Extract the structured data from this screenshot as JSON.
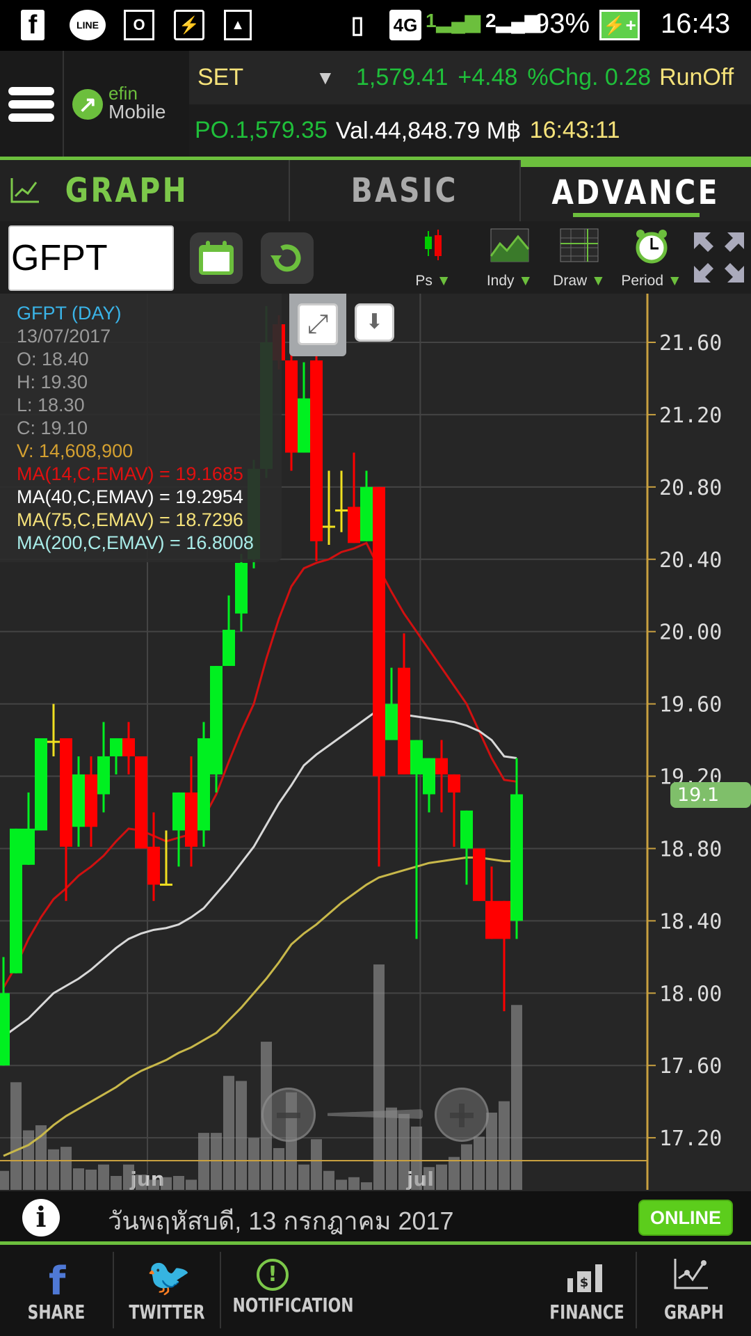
{
  "status_bar": {
    "left_icons": [
      "facebook-icon",
      "line-icon",
      "outlook-icon",
      "battery-saver-icon",
      "gallery-icon"
    ],
    "line_label": "LINE",
    "network": "4G",
    "sim1": "1",
    "sim2": "2",
    "battery": "93%",
    "time": "16:43"
  },
  "header": {
    "logo_line1": "efin",
    "logo_line2": "Mobile",
    "index_name": "SET",
    "index_value": "1,579.41",
    "index_change": "+4.48",
    "pct_change": "%Chg. 0.28",
    "runoff": "RunOff",
    "po": "PO.1,579.35",
    "value": "Val.44,848.79 M฿",
    "timestamp": "16:43:11"
  },
  "tabs": {
    "graph": "GRAPH",
    "basic": "BASIC",
    "advance": "ADVANCE",
    "active": "ADVANCE"
  },
  "toolbar": {
    "symbol": "GFPT",
    "ps": "Ps",
    "indy": "Indy",
    "draw": "Draw",
    "period": "Period",
    "arrow": "▼"
  },
  "info_overlay": {
    "title": "GFPT (DAY)",
    "date": "13/07/2017",
    "open": "O: 18.40",
    "high": "H: 19.30",
    "low": "L: 18.30",
    "close": "C: 19.10",
    "volume": "V: 14,608,900",
    "ma14": "MA(14,C,EMAV) = 19.1685",
    "ma40": "MA(40,C,EMAV) = 19.2954",
    "ma75": "MA(75,C,EMAV) = 18.7296",
    "ma200": "MA(200,C,EMAV) = 16.8008"
  },
  "colors": {
    "up": "#00f020",
    "down": "#ff0000",
    "doji": "#f0e020",
    "ma14": "#d01010",
    "ma40": "#d8d8d8",
    "ma75": "#c8b84a",
    "axis": "#c8a040",
    "accent": "#6cbf3d"
  },
  "chart_data": {
    "type": "candlestick",
    "title": "GFPT (DAY)",
    "ylim": [
      17.07,
      21.87
    ],
    "y_ticks": [
      "21.60",
      "21.20",
      "20.80",
      "20.40",
      "20.00",
      "19.60",
      "19.20",
      "18.80",
      "18.40",
      "18.00",
      "17.60",
      "17.20"
    ],
    "x_labels": [
      {
        "label": "jun",
        "index": 11.5
      },
      {
        "label": "jul",
        "index": 33.3
      }
    ],
    "last_price_label": "19.1",
    "last_price": 19.1,
    "candles": [
      [
        17.6,
        18.2,
        17.6,
        18.0
      ],
      [
        18.11,
        18.91,
        18.11,
        18.91
      ],
      [
        18.71,
        19.11,
        18.71,
        18.91
      ],
      [
        18.9,
        19.41,
        18.9,
        19.41
      ],
      [
        19.39,
        19.6,
        19.31,
        19.39
      ],
      [
        19.41,
        19.41,
        18.51,
        18.81
      ],
      [
        18.92,
        19.31,
        18.81,
        19.21
      ],
      [
        19.21,
        19.31,
        18.81,
        18.92
      ],
      [
        19.1,
        19.5,
        19.0,
        19.31
      ],
      [
        19.31,
        19.41,
        19.21,
        19.41
      ],
      [
        19.41,
        19.5,
        19.21,
        19.31
      ],
      [
        19.31,
        19.31,
        18.8,
        18.8
      ],
      [
        18.81,
        19.0,
        18.51,
        18.6
      ],
      [
        18.6,
        18.9,
        18.6,
        18.6
      ],
      [
        18.9,
        19.11,
        18.7,
        19.11
      ],
      [
        19.11,
        19.31,
        18.7,
        18.81
      ],
      [
        18.9,
        19.5,
        18.81,
        19.41
      ],
      [
        19.21,
        19.81,
        19.11,
        19.81
      ],
      [
        19.81,
        20.2,
        19.81,
        20.01
      ],
      [
        20.1,
        20.43,
        20.0,
        20.38
      ],
      [
        20.4,
        20.95,
        20.35,
        20.9
      ],
      [
        20.9,
        21.8,
        20.85,
        21.6
      ],
      [
        21.7,
        21.75,
        21.45,
        21.5
      ],
      [
        21.5,
        21.55,
        20.89,
        20.99
      ],
      [
        20.99,
        21.49,
        20.99,
        21.29
      ],
      [
        21.5,
        21.55,
        20.39,
        20.5
      ],
      [
        20.58,
        20.89,
        20.48,
        20.58
      ],
      [
        20.67,
        20.89,
        20.55,
        20.67
      ],
      [
        20.69,
        20.99,
        20.49,
        20.49
      ],
      [
        20.5,
        20.89,
        20.5,
        20.8
      ],
      [
        20.8,
        20.8,
        18.7,
        19.2
      ],
      [
        19.4,
        19.8,
        19.4,
        19.6
      ],
      [
        19.8,
        19.99,
        19.21,
        19.21
      ],
      [
        19.21,
        19.4,
        18.3,
        19.4
      ],
      [
        19.1,
        19.3,
        19.0,
        19.3
      ],
      [
        19.3,
        19.4,
        19.0,
        19.21
      ],
      [
        19.21,
        19.21,
        18.81,
        19.11
      ],
      [
        18.8,
        19.01,
        18.6,
        19.01
      ],
      [
        18.8,
        18.8,
        18.51,
        18.51
      ],
      [
        18.51,
        18.7,
        18.3,
        18.3
      ],
      [
        18.51,
        18.51,
        17.9,
        18.3
      ],
      [
        18.4,
        19.3,
        18.3,
        19.1
      ]
    ],
    "volume_millions": [
      1.5,
      8.5,
      4.7,
      5.1,
      3.2,
      3.4,
      1.7,
      1.6,
      2.0,
      1.1,
      2.0,
      1.2,
      0.8,
      1.0,
      1.1,
      0.8,
      4.5,
      4.5,
      9.0,
      8.6,
      4.1,
      11.7,
      3.3,
      7.7,
      2.0,
      4.0,
      1.5,
      0.8,
      1.0,
      0.6,
      17.8,
      6.5,
      6.0,
      5.0,
      1.8,
      2.0,
      2.6,
      3.6,
      4.2,
      6.1,
      7.0,
      14.6
    ],
    "series": [
      {
        "name": "MA(14,C,EMAV)",
        "color_key": "ma14",
        "values": [
          18.03,
          18.15,
          18.3,
          18.42,
          18.52,
          18.58,
          18.65,
          18.7,
          18.76,
          18.84,
          18.91,
          18.9,
          18.87,
          18.84,
          18.86,
          18.88,
          18.97,
          19.1,
          19.28,
          19.45,
          19.6,
          19.85,
          20.07,
          20.25,
          20.35,
          20.38,
          20.4,
          20.44,
          20.46,
          20.49,
          20.35,
          20.22,
          20.1,
          20.0,
          19.9,
          19.8,
          19.7,
          19.6,
          19.45,
          19.3,
          19.18,
          19.17
        ]
      },
      {
        "name": "MA(40,C,EMAV)",
        "color_key": "ma40",
        "values": [
          17.76,
          17.81,
          17.86,
          17.93,
          18.0,
          18.04,
          18.08,
          18.13,
          18.19,
          18.25,
          18.3,
          18.33,
          18.35,
          18.36,
          18.38,
          18.42,
          18.47,
          18.55,
          18.63,
          18.72,
          18.81,
          18.93,
          19.05,
          19.15,
          19.26,
          19.32,
          19.37,
          19.42,
          19.47,
          19.52,
          19.57,
          19.56,
          19.54,
          19.53,
          19.52,
          19.51,
          19.5,
          19.48,
          19.45,
          19.4,
          19.31,
          19.3
        ]
      },
      {
        "name": "MA(75,C,EMAV)",
        "color_key": "ma75",
        "values": [
          17.1,
          17.13,
          17.16,
          17.21,
          17.27,
          17.32,
          17.36,
          17.4,
          17.44,
          17.48,
          17.53,
          17.57,
          17.6,
          17.63,
          17.67,
          17.7,
          17.74,
          17.78,
          17.85,
          17.92,
          18.0,
          18.08,
          18.17,
          18.27,
          18.33,
          18.38,
          18.44,
          18.5,
          18.55,
          18.6,
          18.64,
          18.66,
          18.68,
          18.7,
          18.72,
          18.73,
          18.74,
          18.75,
          18.75,
          18.74,
          18.73,
          18.73
        ]
      }
    ]
  },
  "info_bar": {
    "date_thai": "วันพฤหัสบดี, 13 กรกฎาคม 2017",
    "status": "ONLINE"
  },
  "bottom_nav": {
    "share": "SHARE",
    "twitter": "TWITTER",
    "notification": "NOTIFICATION",
    "finance": "FINANCE",
    "graph": "GRAPH"
  }
}
